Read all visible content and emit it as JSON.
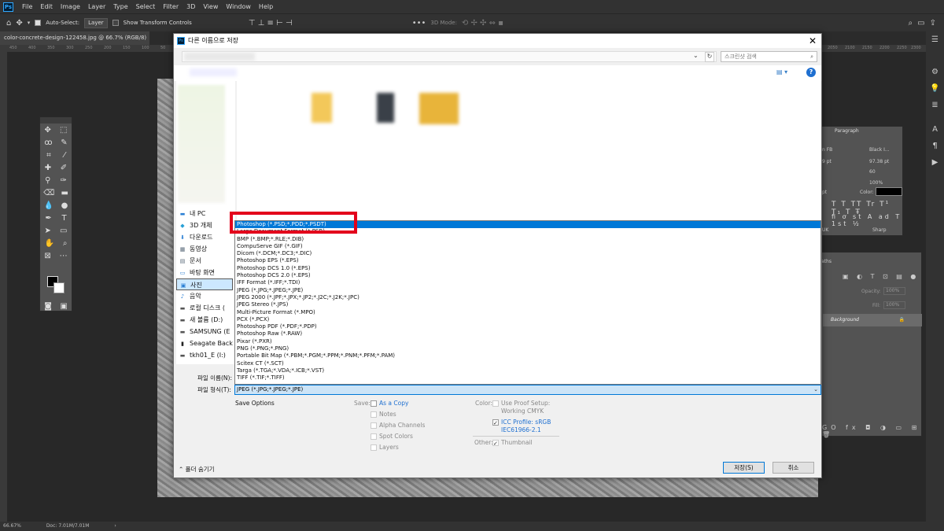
{
  "menubar": {
    "logo": "Ps",
    "items": [
      "File",
      "Edit",
      "Image",
      "Layer",
      "Type",
      "Select",
      "Filter",
      "3D",
      "View",
      "Window",
      "Help"
    ]
  },
  "options_bar": {
    "auto_select": "Auto-Select:",
    "layer_value": "Layer",
    "show_transform": "Show Transform Controls",
    "mode_3d": "3D Mode:"
  },
  "document": {
    "tab_title": "color-concrete-design-122458.jpg @ 66.7% (RGB/8) *",
    "zoom": "66.67%",
    "doc_size": "Doc: 7.01M/7.01M"
  },
  "ruler": {
    "left_ticks": [
      "450",
      "400",
      "350",
      "300",
      "250",
      "200",
      "150",
      "100",
      "50"
    ],
    "right_ticks": [
      "2050",
      "2100",
      "2150",
      "2200",
      "2250",
      "2300",
      "2350"
    ]
  },
  "char_panel": {
    "tab": "Paragraph",
    "font_name": "n FB",
    "font_style": "Black I...",
    "size": "97.38 pt",
    "tracking": "60",
    "scale": "100%",
    "color_label": "Color:",
    "aa": "Sharp",
    "lang": "UK",
    "size2": "9 pt",
    "pt": "pt"
  },
  "layers_panel": {
    "tab": "aths",
    "opacity_label": "Opacity:",
    "opacity": "100%",
    "fill_label": "Fill:",
    "fill": "100%",
    "layer_name": "Background"
  },
  "dialog": {
    "title": "다른 이름으로 저장",
    "search_placeholder": "스크린샷 검색",
    "nav_items": [
      {
        "label": "내 PC",
        "icon": "pc-icon"
      },
      {
        "label": "3D 개체",
        "icon": "3d-objects-icon"
      },
      {
        "label": "다운로드",
        "icon": "download-icon"
      },
      {
        "label": "동영상",
        "icon": "video-icon"
      },
      {
        "label": "문서",
        "icon": "document-icon"
      },
      {
        "label": "바탕 화면",
        "icon": "desktop-icon"
      },
      {
        "label": "사진",
        "icon": "pictures-icon"
      },
      {
        "label": "음악",
        "icon": "music-icon"
      },
      {
        "label": "로컬 디스크 (",
        "icon": "disk-icon"
      },
      {
        "label": "새 볼륨 (D:)",
        "icon": "disk-icon"
      },
      {
        "label": "SAMSUNG (E",
        "icon": "usb-drive-icon"
      },
      {
        "label": "Seagate Back",
        "icon": "usb-drive-icon"
      },
      {
        "label": "tkh01_E (I:)",
        "icon": "network-drive-icon"
      }
    ],
    "file_types": [
      "Photoshop (*.PSD;*.PDD;*.PSDT)",
      "Large Document Format (*.PSB)",
      "BMP (*.BMP;*.RLE;*.DIB)",
      "CompuServe GIF (*.GIF)",
      "Dicom (*.DCM;*.DC3;*.DIC)",
      "Photoshop EPS (*.EPS)",
      "Photoshop DCS 1.0 (*.EPS)",
      "Photoshop DCS 2.0 (*.EPS)",
      "IFF Format (*.IFF;*.TDI)",
      "JPEG (*.JPG;*.JPEG;*.JPE)",
      "JPEG 2000 (*.JPF;*.JPX;*.JP2;*.J2C;*.J2K;*.JPC)",
      "JPEG Stereo (*.JPS)",
      "Multi-Picture Format (*.MPO)",
      "PCX (*.PCX)",
      "Photoshop PDF (*.PDF;*.PDP)",
      "Photoshop Raw (*.RAW)",
      "Pixar (*.PXR)",
      "PNG (*.PNG;*.PNG)",
      "Portable Bit Map (*.PBM;*.PGM;*.PPM;*.PNM;*.PFM;*.PAM)",
      "Scitex CT (*.SCT)",
      "Targa (*.TGA;*.VDA;*.ICB;*.VST)",
      "TIFF (*.TIF;*.TIFF)"
    ],
    "highlighted_index": 0,
    "filename_label": "파일 이름(N):",
    "filetype_label": "파일 형식(T):",
    "filetype_value": "JPEG (*.JPG;*.JPEG;*.JPE)",
    "save_options": "Save Options",
    "save_label": "Save:",
    "as_copy": "As a Copy",
    "notes": "Notes",
    "alpha": "Alpha Channels",
    "spot": "Spot Colors",
    "layers": "Layers",
    "color_label": "Color:",
    "proof_setup": "Use Proof Setup:",
    "proof_value": "Working CMYK",
    "icc": "ICC Profile:  sRGB",
    "icc_value": "IEC61966-2.1",
    "other_label": "Other:",
    "thumbnail": "Thumbnail",
    "hide_folders": "폴더 숨기기",
    "save_button": "저장(S)",
    "cancel_button": "취소"
  },
  "colors": {
    "accent": "#0078d7",
    "highlight_box": "#e3001b"
  }
}
